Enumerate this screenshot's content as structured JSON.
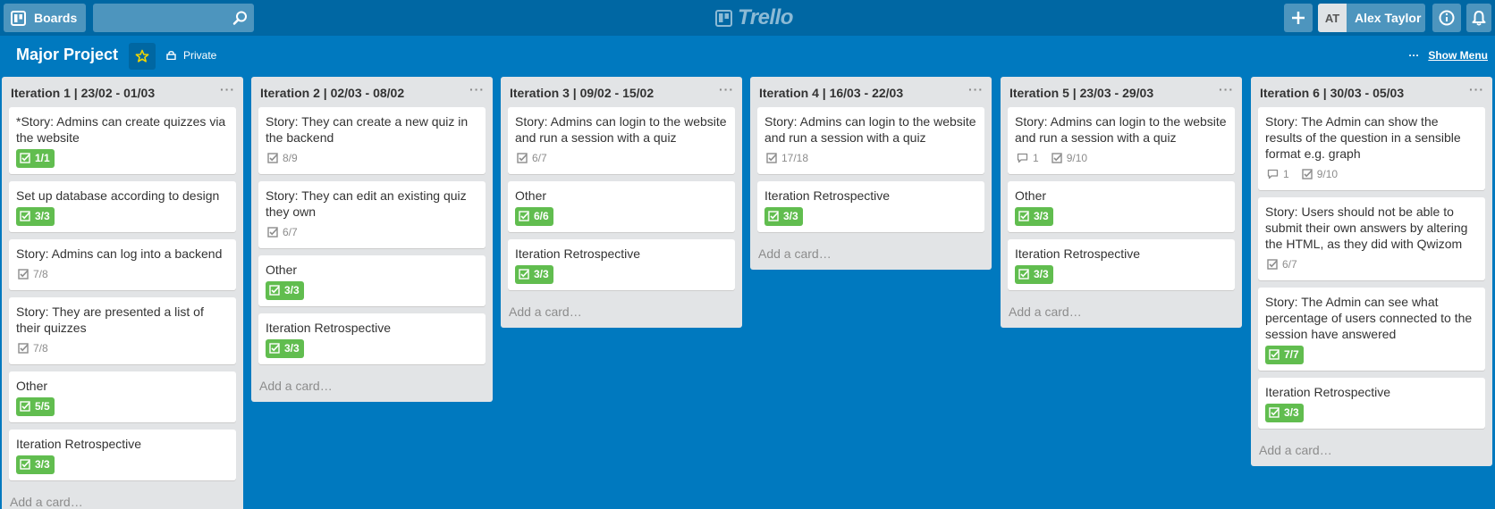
{
  "header": {
    "boards_label": "Boards",
    "logo_text": "Trello",
    "user_initials": "AT",
    "user_name": "Alex Taylor"
  },
  "board": {
    "title": "Major Project",
    "privacy": "Private",
    "menu_dots": "···",
    "show_menu": "Show Menu"
  },
  "list_menu": "···",
  "lists": [
    {
      "title": "Iteration 1 | 23/02 - 01/03",
      "add_card": "Add a card…",
      "cards": [
        {
          "title": "*Story: Admins can create quizzes via the website",
          "checklist": "1/1",
          "done": true
        },
        {
          "title": "Set up database according to design",
          "checklist": "3/3",
          "done": true
        },
        {
          "title": "Story: Admins can log into a backend",
          "checklist": "7/8",
          "done": false
        },
        {
          "title": "Story: They are presented a list of their quizzes",
          "checklist": "7/8",
          "done": false
        },
        {
          "title": "Other",
          "checklist": "5/5",
          "done": true
        },
        {
          "title": "Iteration Retrospective",
          "checklist": "3/3",
          "done": true
        }
      ]
    },
    {
      "title": "Iteration 2 | 02/03 - 08/02",
      "add_card": "Add a card…",
      "cards": [
        {
          "title": "Story: They can create a new quiz in the backend",
          "checklist": "8/9",
          "done": false
        },
        {
          "title": "Story: They can edit an existing quiz they own",
          "checklist": "6/7",
          "done": false
        },
        {
          "title": "Other",
          "checklist": "3/3",
          "done": true
        },
        {
          "title": "Iteration Retrospective",
          "checklist": "3/3",
          "done": true
        }
      ]
    },
    {
      "title": "Iteration 3 | 09/02 - 15/02",
      "add_card": "Add a card…",
      "cards": [
        {
          "title": "Story: Admins can login to the website and run a session with a quiz",
          "checklist": "6/7",
          "done": false
        },
        {
          "title": "Other",
          "checklist": "6/6",
          "done": true
        },
        {
          "title": "Iteration Retrospective",
          "checklist": "3/3",
          "done": true
        }
      ]
    },
    {
      "title": "Iteration 4 | 16/03 - 22/03",
      "add_card": "Add a card…",
      "cards": [
        {
          "title": "Story: Admins can login to the website and run a session with a quiz",
          "checklist": "17/18",
          "done": false
        },
        {
          "title": "Iteration Retrospective",
          "checklist": "3/3",
          "done": true
        }
      ]
    },
    {
      "title": "Iteration 5 | 23/03 - 29/03",
      "add_card": "Add a card…",
      "cards": [
        {
          "title": "Story: Admins can login to the website and run a session with a quiz",
          "comments": "1",
          "checklist": "9/10",
          "done": false
        },
        {
          "title": "Other",
          "checklist": "3/3",
          "done": true
        },
        {
          "title": "Iteration Retrospective",
          "checklist": "3/3",
          "done": true
        }
      ]
    },
    {
      "title": "Iteration 6 | 30/03 - 05/03",
      "add_card": "Add a card…",
      "cards": [
        {
          "title": "Story: The Admin can show the results of the question in a sensible format e.g. graph",
          "comments": "1",
          "checklist": "9/10",
          "done": false
        },
        {
          "title": "Story: Users should not be able to submit their own answers by altering the HTML, as they did with Qwizom",
          "checklist": "6/7",
          "done": false
        },
        {
          "title": "Story: The Admin can see what percentage of users connected to the session have answered",
          "checklist": "7/7",
          "done": true
        },
        {
          "title": "Iteration Retrospective",
          "checklist": "3/3",
          "done": true
        }
      ]
    }
  ],
  "colors": {
    "board_bg": "#0079bf",
    "header_bg": "#0067a3",
    "list_bg": "#e2e4e6",
    "complete_badge": "#61bd4f",
    "star": "#f2d600"
  },
  "icons": {
    "boards": "boards-icon",
    "search": "search-icon",
    "add": "plus-icon",
    "info": "info-icon",
    "notifications": "bell-icon",
    "star": "star-icon",
    "privacy": "lock-icon",
    "checklist": "checklist-icon",
    "comments": "comment-icon"
  }
}
